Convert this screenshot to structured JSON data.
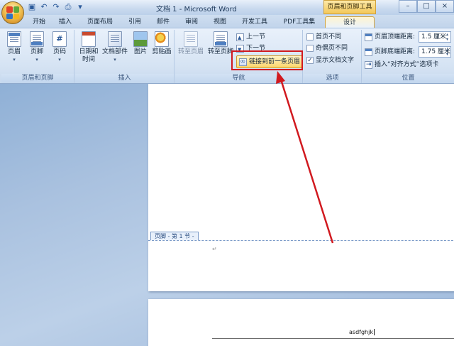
{
  "app": {
    "title": "文档 1 - Microsoft Word",
    "context_tab_group": "页眉和页脚工具",
    "window_controls": [
      "–",
      "□",
      "×"
    ],
    "quick_access_icons": [
      "save-icon",
      "undo-icon",
      "redo-icon",
      "print-preview-icon",
      "customize-icon"
    ]
  },
  "tabs": [
    {
      "label": "开始"
    },
    {
      "label": "插入"
    },
    {
      "label": "页面布局"
    },
    {
      "label": "引用"
    },
    {
      "label": "邮件"
    },
    {
      "label": "审阅"
    },
    {
      "label": "视图"
    },
    {
      "label": "开发工具"
    },
    {
      "label": "PDF工具集"
    },
    {
      "label": "设计",
      "active": true
    }
  ],
  "ribbon": {
    "group_header_footer": {
      "label": "页眉和页脚",
      "buttons": [
        {
          "label": "页眉"
        },
        {
          "label": "页脚"
        },
        {
          "label": "页码"
        }
      ]
    },
    "group_insert": {
      "label": "插入",
      "buttons": [
        {
          "label": "日期和\n时间"
        },
        {
          "label": "文档部件"
        },
        {
          "label": "图片"
        },
        {
          "label": "剪贴画"
        }
      ]
    },
    "group_navigation": {
      "label": "导航",
      "goto_header": "转至页眉",
      "goto_footer": "转至页脚",
      "prev_section": "上一节",
      "next_section": "下一节",
      "link_to_previous": "链接到前一条页眉"
    },
    "group_options": {
      "label": "选项",
      "items": [
        {
          "label": "首页不同",
          "checked": false
        },
        {
          "label": "奇偶页不同",
          "checked": false
        },
        {
          "label": "显示文档文字",
          "checked": true
        }
      ]
    },
    "group_position": {
      "label": "位置",
      "header_top_label": "页眉顶端距离:",
      "header_top_value": "1.5 厘米",
      "footer_bottom_label": "页脚底端距离:",
      "footer_bottom_value": "1.75 厘米",
      "insert_align_tab": "插入“对齐方式”选项卡"
    }
  },
  "document": {
    "footer_tag": "页脚 - 第 1 节 -",
    "paragraph_mark": "↵",
    "page2_text": "asdfghjk"
  },
  "colors": {
    "highlight": "#d1191f",
    "accent": "#4f7fc0"
  }
}
